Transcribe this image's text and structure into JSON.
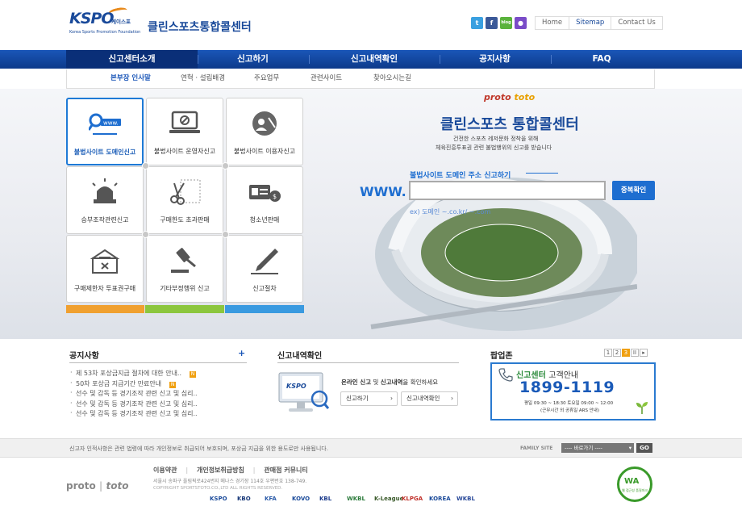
{
  "header": {
    "logo_text": "KSPO",
    "logo_kor": "케이스포",
    "logo_sub": "Korea Sports Promotion Foundation",
    "site_title": "클린스포츠통합콜센터",
    "sns": [
      {
        "icon": "twitter-icon",
        "glyph": "t",
        "color": "#3aa0e0"
      },
      {
        "icon": "facebook-icon",
        "glyph": "f",
        "color": "#3b5998"
      },
      {
        "icon": "blog-icon",
        "glyph": "blog",
        "color": "#5ab33c"
      },
      {
        "icon": "me2day-icon",
        "glyph": "●",
        "color": "#7a4cc8"
      }
    ],
    "util_links": [
      "Home",
      "Sitemap",
      "Contact Us"
    ]
  },
  "gnb": [
    "신고센터소개",
    "신고하기",
    "신고내역확인",
    "공지사항",
    "FAQ"
  ],
  "lnb": [
    "본부장 인사말",
    "연혁 · 설립배경",
    "주요업무",
    "관련사이트",
    "찾아오시는길"
  ],
  "tiles": [
    {
      "label": "불법사이트 도메인신고",
      "icon": "domain-search-icon",
      "selected": true
    },
    {
      "label": "불법사이트 운영자신고",
      "icon": "laptop-block-icon",
      "selected": false
    },
    {
      "label": "불법사이트 이용자신고",
      "icon": "user-block-icon",
      "selected": false
    },
    {
      "label": "승부조작관련신고",
      "icon": "siren-icon",
      "selected": false
    },
    {
      "label": "구매한도 초과판매",
      "icon": "scissors-icon",
      "selected": false
    },
    {
      "label": "청소년판매",
      "icon": "id-card-icon",
      "selected": false
    },
    {
      "label": "구매제한자 투표권구매",
      "icon": "ballot-box-icon",
      "selected": false
    },
    {
      "label": "기타부정행위 신고",
      "icon": "gavel-icon",
      "selected": false
    },
    {
      "label": "신고절차",
      "icon": "pen-icon",
      "selected": false
    }
  ],
  "tile_bar_colors": [
    "#f0a030",
    "#8cc63e",
    "#3a9ae0"
  ],
  "hero": {
    "brand_proto": "proto",
    "brand_toto": "toto",
    "title": "클린스포츠 통합콜센터",
    "desc_line1": "건전한 스포츠 레저문화 정착을 위해",
    "desc_line2": "체육진흥투표권 관련 불법행위의 신고를 받습니다",
    "search_label": "불법사이트 도메인 주소 신고하기",
    "www": "WWW.",
    "search_value": "",
    "search_button": "중복확인",
    "example": "ex) 도메인 ~.co.kr/ ~.com"
  },
  "notice": {
    "title": "공지사항",
    "more": "+",
    "items": [
      {
        "text": "제 53차 포상금지급 절차에 대한 안내..",
        "new": true
      },
      {
        "text": "50차 포상금 지급기간 만료안내",
        "new": true
      },
      {
        "text": "선수 및 감독 등 경기조작 관련 신고 및 심리..",
        "new": false
      },
      {
        "text": "선수 및 감독 등 경기조작 관련 신고 및 심리..",
        "new": false
      },
      {
        "text": "선수 및 감독 등 경기조작 관련 신고 및 심리..",
        "new": false
      }
    ],
    "new_badge": "N"
  },
  "history": {
    "title": "신고내역확인",
    "monitor_text": "KSPO",
    "desc_pre": "온라인 신고",
    "desc_mid": " 및 ",
    "desc_bold": "신고내역",
    "desc_post": "을 확인하세요",
    "btn1": "신고하기",
    "btn2": "신고내역확인"
  },
  "popup": {
    "title": "팝업존",
    "pages": [
      "1",
      "2",
      "3",
      "II",
      "▸"
    ],
    "active_page": "3",
    "center_title": "신고센터",
    "center_sub": "고객안내",
    "phone": "1899-1119",
    "hours": "평일 09:30 ~ 18:30  토요일 09:00 ~ 12:00",
    "note": "(근무시간 외 공휴일 ARS 안내)"
  },
  "footer": {
    "privacy_notice": "신고자 인적사항은 관련 법령에 따라 개인정보로 취급되어 보호되며, 포상금 지급을 위한 용도로만 사용됩니다.",
    "family_label": "FAMILY SITE",
    "family_select": "---- 바로가기 ----",
    "go": "GO",
    "links": [
      "이용약관",
      "개인정보취급방침",
      "관매점 커뮤니티"
    ],
    "address": "서울시 송파구 올림픽로424번지 메나스 경기장 114호 우편번호 138-749.",
    "copyright": "COPYRIGHT SPORTSTOTO.CO.,LTD ALL RIGHTS RESERVED.",
    "brand_proto": "proto",
    "brand_toto": "toto",
    "partners": [
      "KSPO",
      "KBO",
      "KFA",
      "KOVO",
      "KBL",
      "WKBL",
      "K-League",
      "KLPGA",
      "KOREA",
      "WKBL"
    ],
    "badge_main": "WA",
    "badge_sub": "웹 접근성 품질마크"
  }
}
